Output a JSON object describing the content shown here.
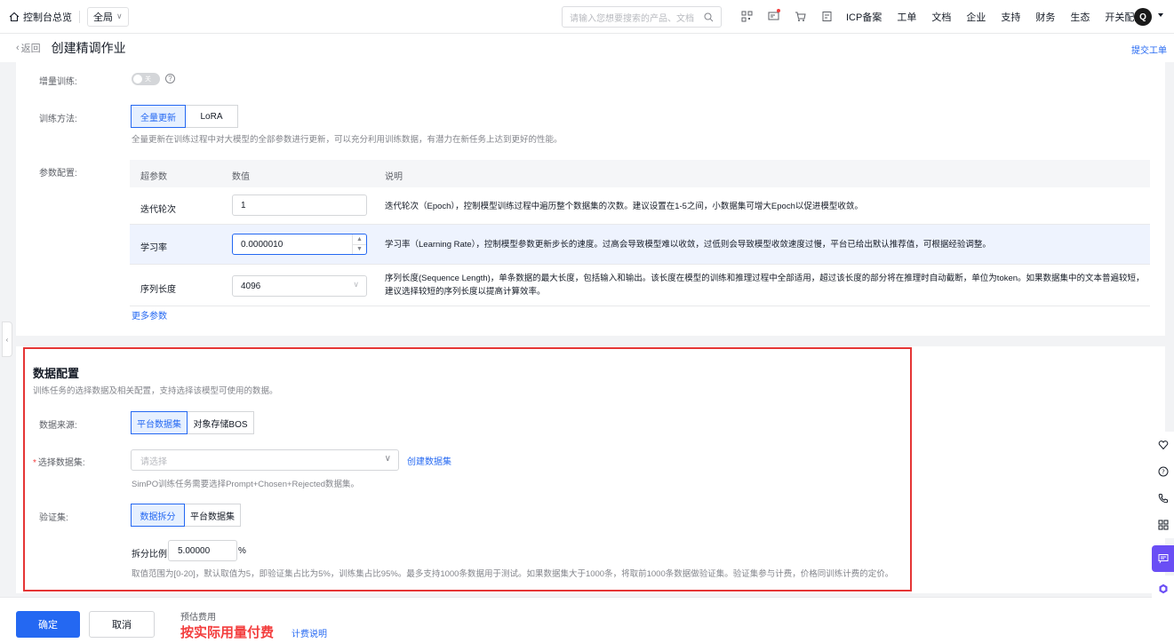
{
  "topbar": {
    "home": "控制台总览",
    "region": "全局",
    "search_placeholder": "请输入您想要搜索的产品、文档",
    "links": [
      "ICP备案",
      "工单",
      "文档",
      "企业",
      "支持",
      "财务",
      "生态",
      "开关配置"
    ],
    "avatar": "Q"
  },
  "header": {
    "back": "返回",
    "title": "创建精调作业",
    "submit_ticket": "提交工单"
  },
  "training": {
    "incremental_label": "增量训练:",
    "incremental_toggle": "关",
    "method_label": "训练方法:",
    "methods": [
      "全量更新",
      "LoRA"
    ],
    "method_hint": "全量更新在训练过程中对大模型的全部参数进行更新，可以充分利用训练数据，有潜力在新任务上达到更好的性能。",
    "param_label": "参数配置:",
    "table_headers": [
      "超参数",
      "数值",
      "说明"
    ],
    "rows": [
      {
        "name": "迭代轮次",
        "value": "1",
        "desc": "迭代轮次（Epoch），控制模型训练过程中遍历整个数据集的次数。建议设置在1-5之间，小数据集可增大Epoch以促进模型收敛。"
      },
      {
        "name": "学习率",
        "value": "0.0000010",
        "desc": "学习率（Learning Rate），控制模型参数更新步长的速度。过高会导致模型难以收敛，过低则会导致模型收敛速度过慢，平台已给出默认推荐值，可根据经验调整。"
      },
      {
        "name": "序列长度",
        "value": "4096",
        "desc": "序列长度(Sequence Length)，单条数据的最大长度，包括输入和输出。该长度在模型的训练和推理过程中全部适用，超过该长度的部分将在推理时自动截断，单位为token。如果数据集中的文本普遍较短，建议选择较短的序列长度以提高计算效率。"
      }
    ],
    "more_params": "更多参数"
  },
  "data_config": {
    "title": "数据配置",
    "subtitle": "训练任务的选择数据及相关配置，支持选择该模型可使用的数据。",
    "source_label": "数据来源:",
    "sources": [
      "平台数据集",
      "对象存储BOS"
    ],
    "dataset_label": "选择数据集:",
    "dataset_required": "*",
    "dataset_placeholder": "请选择",
    "create_dataset": "创建数据集",
    "dataset_hint": "SimPO训练任务需要选择Prompt+Chosen+Rejected数据集。",
    "validation_label": "验证集:",
    "validation_options": [
      "数据拆分",
      "平台数据集"
    ],
    "split_label": "拆分比例",
    "split_value": "5.00000",
    "split_unit": "%",
    "split_hint": "取值范围为[0-20]，默认取值为5，即验证集占比为5%，训练集占比95%。最多支持1000条数据用于测试。如果数据集大于1000条，将取前1000条数据做验证集。验证集参与计费，价格同训练计费的定价。"
  },
  "footer": {
    "confirm": "确定",
    "cancel": "取消",
    "cost_label": "预估费用",
    "cost_value": "按实际用量付费",
    "cost_link": "计费说明"
  },
  "colors": {
    "primary": "#2468f2",
    "danger": "#f33e3e",
    "highlight_box": "#e53535"
  }
}
